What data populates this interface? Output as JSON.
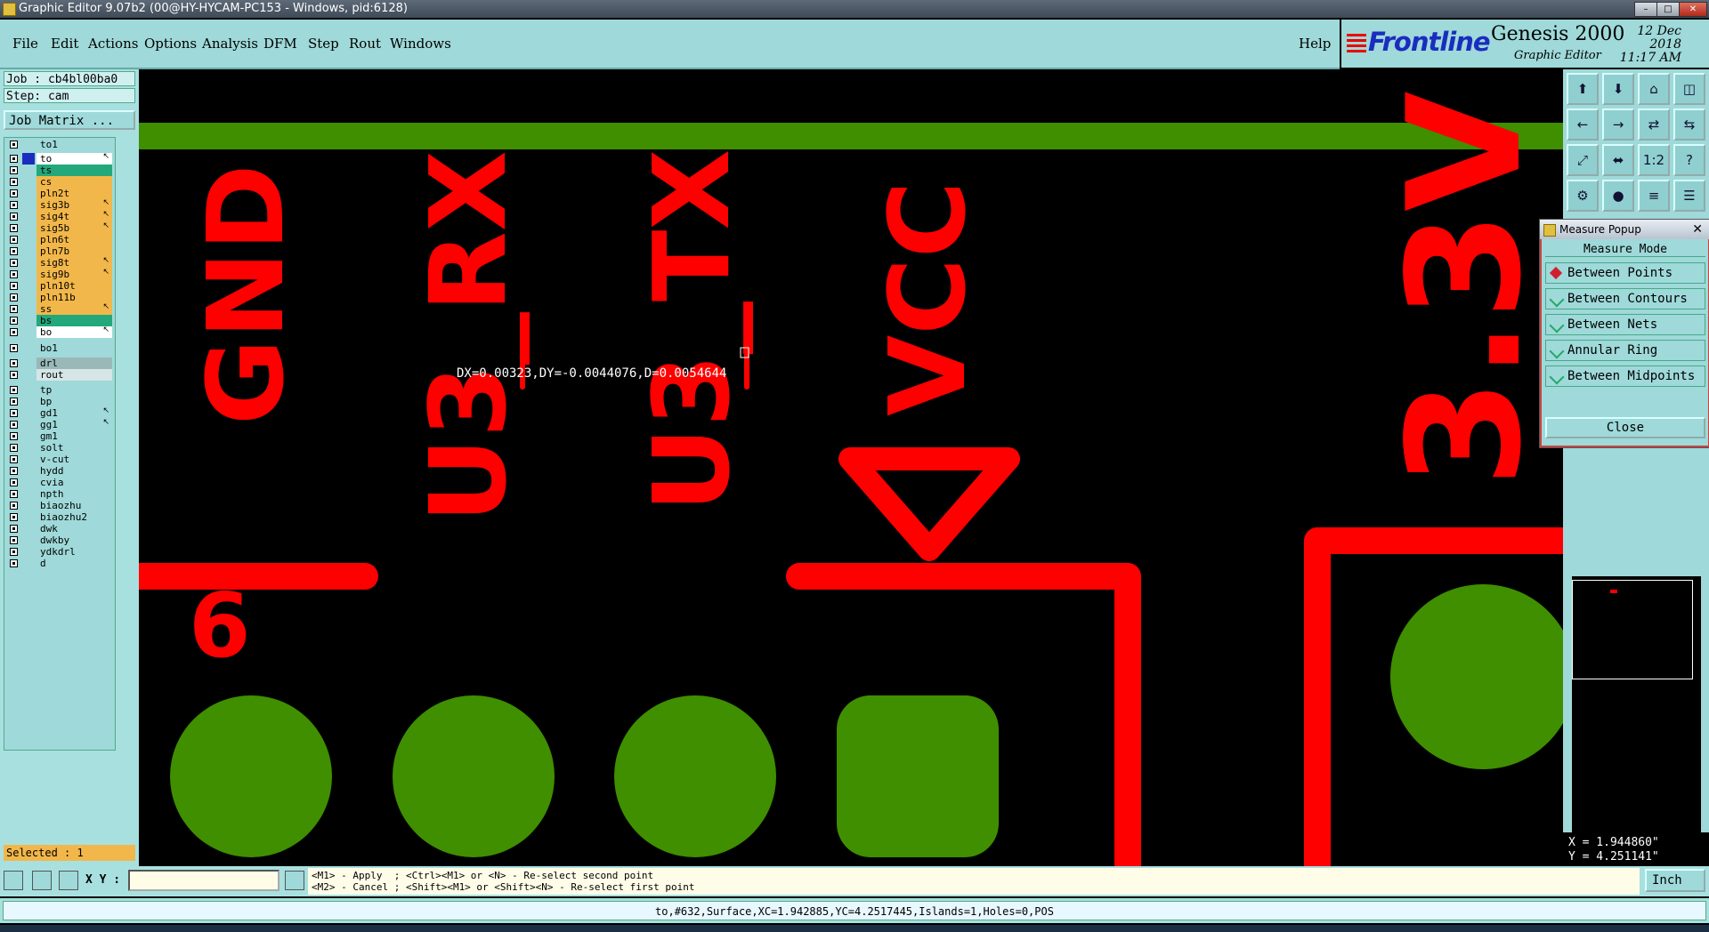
{
  "window": {
    "title": "Graphic Editor 9.07b2 (00@HY-HYCAM-PC153 - Windows, pid:6128)",
    "min_label": "–",
    "max_label": "□",
    "close_label": "✕"
  },
  "menu": {
    "items": [
      "File",
      "Edit",
      "Actions",
      "Options",
      "Analysis",
      "DFM",
      "Step",
      "Rout",
      "Windows"
    ],
    "help": "Help"
  },
  "brand": {
    "logo": "Frontline",
    "product": "Genesis 2000",
    "subtitle": "Graphic Editor",
    "date": "12 Dec 2018",
    "time": "11:17 AM"
  },
  "job": {
    "job_line": "Job : cb4bl00ba0",
    "step_line": "Step: cam",
    "matrix_button": "Job Matrix ..."
  },
  "layers": [
    {
      "name": "to1",
      "color": "#9fd9d9"
    },
    {
      "name": "to",
      "color": "#ffffff",
      "active": true
    },
    {
      "name": "ts",
      "color": "#22a87a"
    },
    {
      "name": "cs",
      "color": "#f2b74a"
    },
    {
      "name": "pln2t",
      "color": "#f2b74a"
    },
    {
      "name": "sig3b",
      "color": "#f2b74a"
    },
    {
      "name": "sig4t",
      "color": "#f2b74a"
    },
    {
      "name": "sig5b",
      "color": "#f2b74a"
    },
    {
      "name": "pln6t",
      "color": "#f2b74a"
    },
    {
      "name": "pln7b",
      "color": "#f2b74a"
    },
    {
      "name": "sig8t",
      "color": "#f2b74a"
    },
    {
      "name": "sig9b",
      "color": "#f2b74a"
    },
    {
      "name": "pln10t",
      "color": "#f2b74a"
    },
    {
      "name": "pln11b",
      "color": "#f2b74a"
    },
    {
      "name": "ss",
      "color": "#f2b74a"
    },
    {
      "name": "bs",
      "color": "#22a87a"
    },
    {
      "name": "bo",
      "color": "#ffffff"
    },
    {
      "name": "bo1",
      "color": "#9fd9d9"
    },
    {
      "name": "drl",
      "color": "#9ab8b8"
    },
    {
      "name": "rout",
      "color": "#d6e6e6"
    },
    {
      "name": "tp",
      "color": "#9fd9d9"
    },
    {
      "name": "bp",
      "color": "#9fd9d9"
    },
    {
      "name": "gd1",
      "color": "#9fd9d9"
    },
    {
      "name": "gg1",
      "color": "#9fd9d9"
    },
    {
      "name": "gm1",
      "color": "#9fd9d9"
    },
    {
      "name": "solt",
      "color": "#9fd9d9"
    },
    {
      "name": "v-cut",
      "color": "#9fd9d9"
    },
    {
      "name": "hydd",
      "color": "#9fd9d9"
    },
    {
      "name": "cvia",
      "color": "#9fd9d9"
    },
    {
      "name": "npth",
      "color": "#9fd9d9"
    },
    {
      "name": "biaozhu",
      "color": "#9fd9d9"
    },
    {
      "name": "biaozhu2",
      "color": "#9fd9d9"
    },
    {
      "name": "dwk",
      "color": "#9fd9d9"
    },
    {
      "name": "dwkby",
      "color": "#9fd9d9"
    },
    {
      "name": "ydkdrl",
      "color": "#9fd9d9"
    },
    {
      "name": "d",
      "color": "#9fd9d9"
    }
  ],
  "selected": "Selected : 1",
  "canvas": {
    "labels": [
      "GND",
      "U3_RX",
      "U3_TX",
      "VCC",
      "3.3V",
      "6"
    ],
    "measure_readout": "DX=0.00323,DY=-0.0044076,D=0.0054644",
    "copper_color": "#3f8f00",
    "silk_color": "#ff0000"
  },
  "measure_popup": {
    "title": "Measure Popup",
    "section": "Measure Mode",
    "modes": [
      "Between Points",
      "Between Contours",
      "Between Nets",
      "Annular Ring",
      "Between Midpoints"
    ],
    "selected_mode": "Between Points",
    "close_button": "Close"
  },
  "coords": {
    "x": "X = 1.944860\"",
    "y": "Y = 4.251141\""
  },
  "command": {
    "xy_label": "X Y :",
    "xy_value": "",
    "hint_line1": "<M1> - Apply  ; <Ctrl><M1> or <N> - Re-select second point",
    "hint_line2": "<M2> - Cancel ; <Shift><M1> or <Shift><N> - Re-select first point",
    "units": "Inch"
  },
  "status": "to,#632,Surface,XC=1.942885,YC=4.2517445,Islands=1,Holes=0,POS",
  "toolbar_icons": [
    "open-icon",
    "save-icon",
    "home-icon",
    "window-icon",
    "pan-left-icon",
    "pan-right-icon",
    "zoom-icon",
    "snap-icon",
    "fit-icon",
    "zoom-fit-icon",
    "scale-icon",
    "help-icon",
    "tool-icon",
    "probe-icon",
    "measure-icon",
    "settings-icon"
  ]
}
